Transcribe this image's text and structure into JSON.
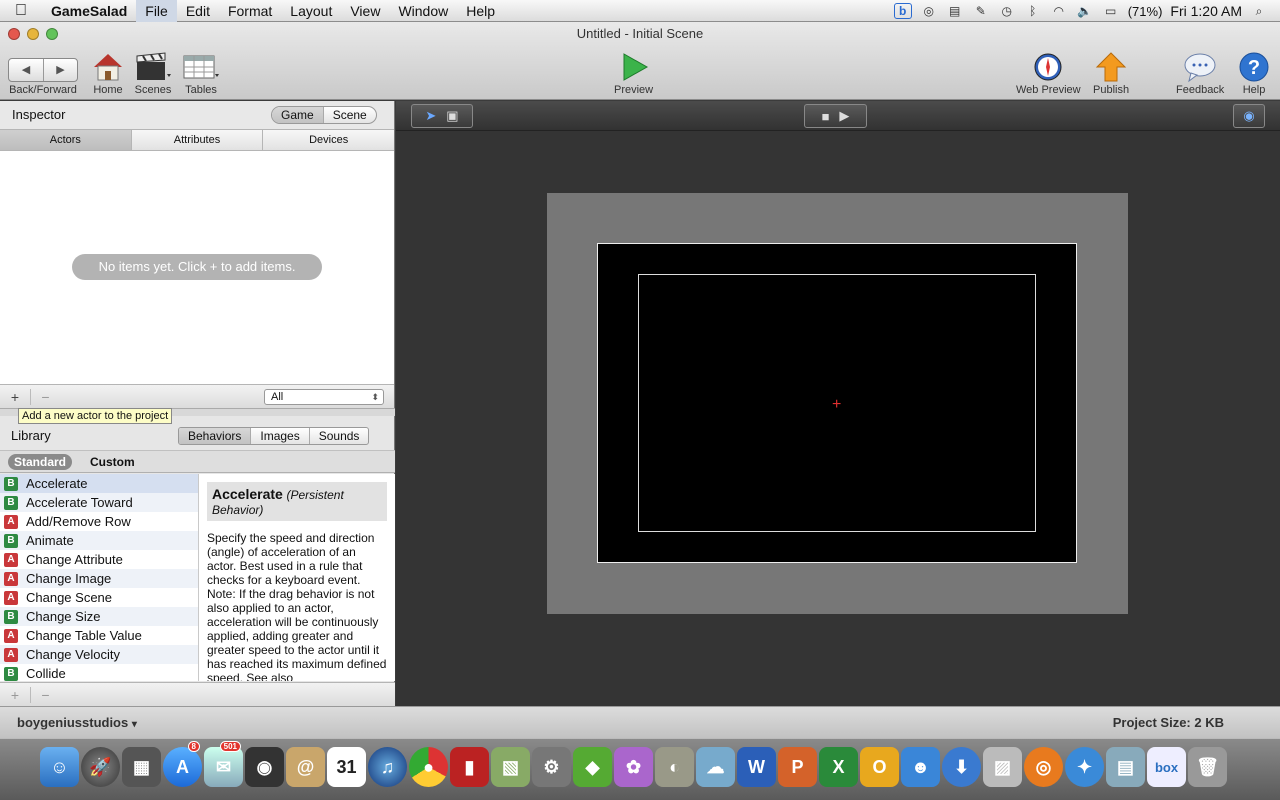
{
  "menubar": {
    "app_name": "GameSalad",
    "items": [
      "File",
      "Edit",
      "Format",
      "Layout",
      "View",
      "Window",
      "Help"
    ],
    "battery": "(71%)",
    "clock": "Fri 1:20 AM"
  },
  "window": {
    "title": "Untitled - Initial Scene"
  },
  "toolbar": {
    "back_forward": "Back/Forward",
    "home": "Home",
    "scenes": "Scenes",
    "tables": "Tables",
    "preview": "Preview",
    "web_preview": "Web Preview",
    "publish": "Publish",
    "feedback": "Feedback",
    "help": "Help"
  },
  "inspector": {
    "title": "Inspector",
    "seg": [
      "Game",
      "Scene"
    ],
    "tabs": [
      "Actors",
      "Attributes",
      "Devices"
    ],
    "empty_message": "No items yet. Click + to add items.",
    "plus": "+",
    "minus": "−",
    "filter_value": "All",
    "tooltip": "Add a new actor to the project"
  },
  "library": {
    "title": "Library",
    "tabs": [
      "Behaviors",
      "Images",
      "Sounds"
    ],
    "std": "Standard",
    "custom": "Custom",
    "items": [
      {
        "badge": "B",
        "label": "Accelerate"
      },
      {
        "badge": "B",
        "label": "Accelerate Toward"
      },
      {
        "badge": "A",
        "label": "Add/Remove Row"
      },
      {
        "badge": "B",
        "label": "Animate"
      },
      {
        "badge": "A",
        "label": "Change Attribute"
      },
      {
        "badge": "A",
        "label": "Change Image"
      },
      {
        "badge": "A",
        "label": "Change Scene"
      },
      {
        "badge": "B",
        "label": "Change Size"
      },
      {
        "badge": "A",
        "label": "Change Table Value"
      },
      {
        "badge": "A",
        "label": "Change Velocity"
      },
      {
        "badge": "B",
        "label": "Collide"
      }
    ],
    "desc_title": "Accelerate",
    "desc_subtitle": "(Persistent Behavior)",
    "desc_body": "Specify the speed and direction (angle) of acceleration of an actor. Best used in a rule that checks for a keyboard event. Note: If the drag behavior is not also applied to an actor, acceleration will be continuously applied, adding greater and greater speed to the actor until it has reached its maximum defined speed. See also"
  },
  "status": {
    "user": "boygeniusstudios",
    "project_size": "Project Size: 2 KB"
  },
  "dock": {
    "calendar_date": "31",
    "mail_badge": "501",
    "appstore_badge": "8"
  }
}
